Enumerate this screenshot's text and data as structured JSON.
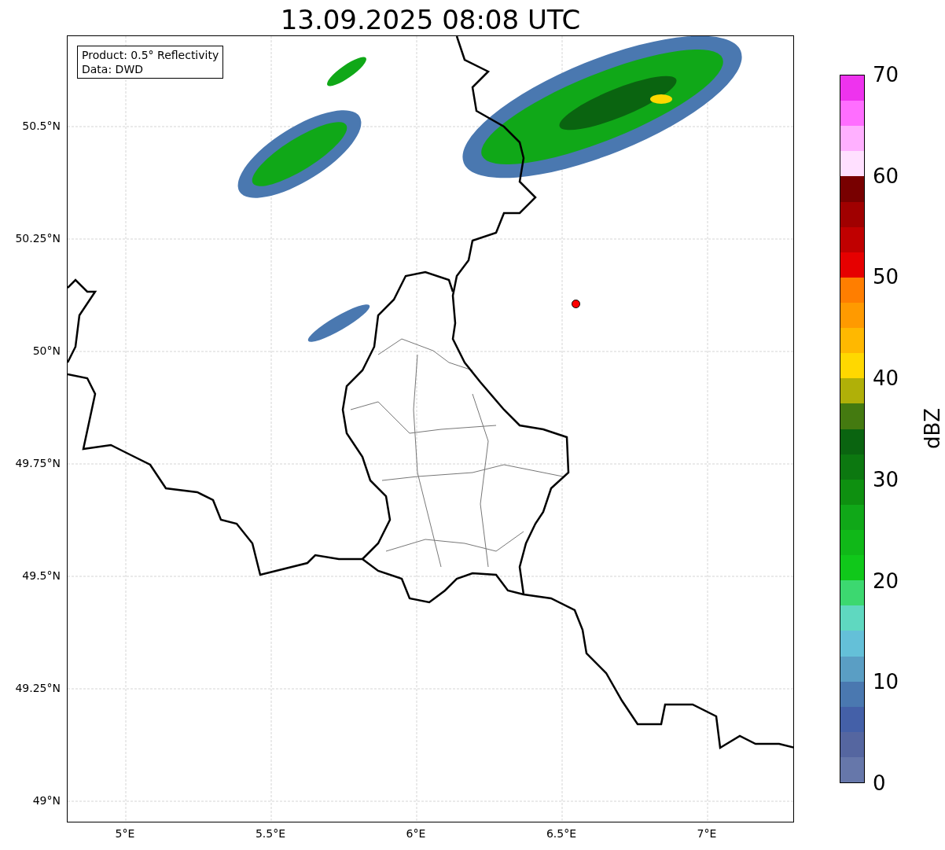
{
  "title": "13.09.2025 08:08 UTC",
  "info_box": [
    "Product: 0.5° Reflectivity",
    "Data: DWD"
  ],
  "map": {
    "lat_ticks": [
      "50.5°N",
      "50.25°N",
      "50°N",
      "49.75°N",
      "49.5°N",
      "49.25°N",
      "49°N"
    ],
    "lon_ticks": [
      "5°E",
      "5.5°E",
      "6°E",
      "6.5°E",
      "7°E"
    ]
  },
  "colorbar": {
    "label": "dBZ",
    "ticks": [
      "70",
      "60",
      "50",
      "40",
      "30",
      "20",
      "10",
      "0"
    ],
    "bins": [
      {
        "color": "#ee33ee"
      },
      {
        "color": "#ff6eff"
      },
      {
        "color": "#ffb0ff"
      },
      {
        "color": "#ffe0ff"
      },
      {
        "color": "#780000"
      },
      {
        "color": "#a00000"
      },
      {
        "color": "#c00000"
      },
      {
        "color": "#e60000"
      },
      {
        "color": "#ff7e00"
      },
      {
        "color": "#ff9a00"
      },
      {
        "color": "#ffb800"
      },
      {
        "color": "#ffd800"
      },
      {
        "color": "#b0b008"
      },
      {
        "color": "#447a10"
      },
      {
        "color": "#0a6410"
      },
      {
        "color": "#0c7810"
      },
      {
        "color": "#0e9010"
      },
      {
        "color": "#10a818"
      },
      {
        "color": "#10b818"
      },
      {
        "color": "#10c81a"
      },
      {
        "color": "#3cd870"
      },
      {
        "color": "#5fd8c0"
      },
      {
        "color": "#64c0d8"
      },
      {
        "color": "#5a9ec4"
      },
      {
        "color": "#4a78b0"
      },
      {
        "color": "#4460a8"
      },
      {
        "color": "#5566a0"
      },
      {
        "color": "#6677aa"
      }
    ]
  }
}
